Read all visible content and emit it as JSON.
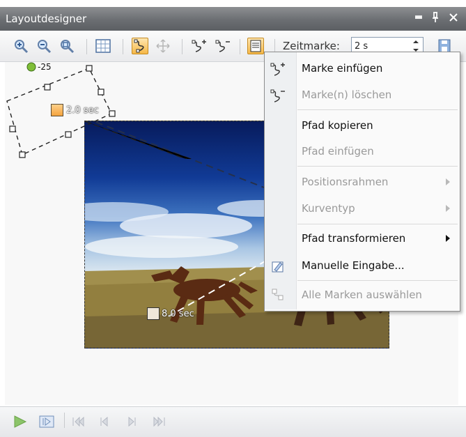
{
  "title": "Layoutdesigner",
  "toolbar": {
    "zeitmarke_label": "Zeitmarke:",
    "zeitmarke_value": "2 s"
  },
  "canvas": {
    "angle_label": "-25",
    "time_start": "2.0 sec",
    "time_end": "8.0 sec"
  },
  "context_menu": {
    "items": [
      {
        "label": "Marke einfügen",
        "icon": "add-marker-icon",
        "enabled": true
      },
      {
        "label": "Marke(n) löschen",
        "icon": "delete-marker-icon",
        "enabled": false
      },
      {
        "label": "Pfad kopieren",
        "enabled": true
      },
      {
        "label": "Pfad einfügen",
        "enabled": false
      },
      {
        "label": "Positionsrahmen",
        "enabled": false,
        "submenu": true
      },
      {
        "label": "Kurventyp",
        "enabled": false,
        "submenu": true
      },
      {
        "label": "Pfad transformieren",
        "enabled": true,
        "submenu": true
      },
      {
        "label": "Manuelle Eingabe...",
        "icon": "manual-input-icon",
        "enabled": true
      },
      {
        "label": "Alle Marken auswählen",
        "icon": "select-all-markers-icon",
        "enabled": false
      }
    ]
  },
  "colors": {
    "titlebar": "#6b6e72",
    "active_button": "#f6b847",
    "disabled_text": "#9a9a9a"
  }
}
